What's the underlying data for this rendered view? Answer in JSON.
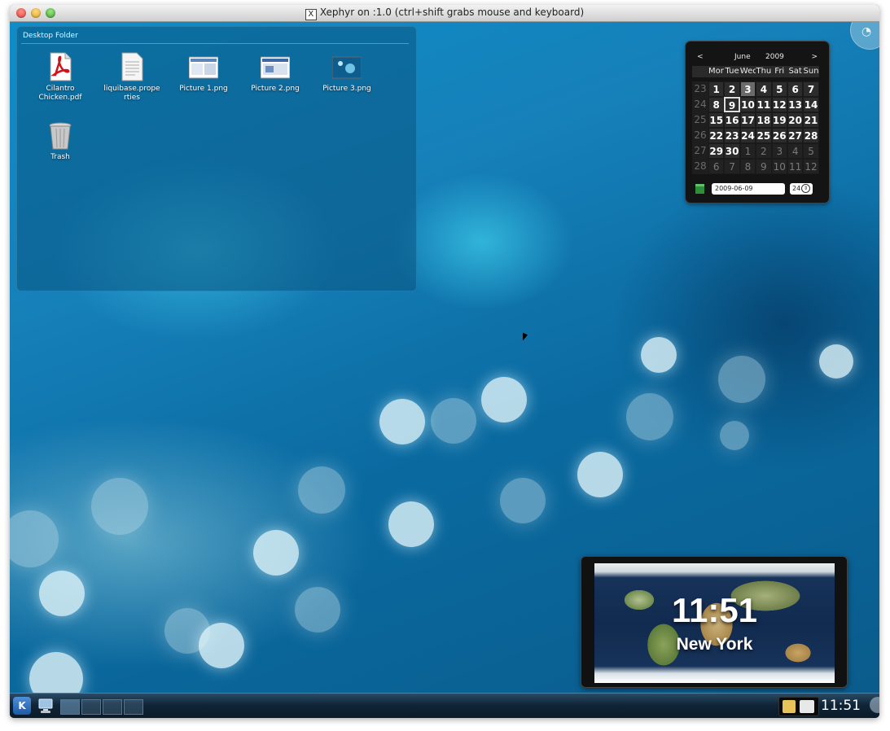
{
  "window": {
    "title": "Xephyr on :1.0 (ctrl+shift grabs mouse and keyboard)",
    "title_icon": "X"
  },
  "folder": {
    "title": "Desktop Folder",
    "items": [
      {
        "label": "Cilantro Chicken.pdf",
        "icon": "pdf-icon"
      },
      {
        "label": "liquibase.properties",
        "icon": "text-file-icon"
      },
      {
        "label": "Picture 1.png",
        "icon": "image-icon"
      },
      {
        "label": "Picture 2.png",
        "icon": "image-icon"
      },
      {
        "label": "Picture 3.png",
        "icon": "image-icon"
      },
      {
        "label": "Trash",
        "icon": "trash-icon"
      }
    ]
  },
  "calendar": {
    "prev": "<",
    "next": ">",
    "month": "June",
    "year": "2009",
    "day_names": [
      "Mon",
      "Tue",
      "Wed",
      "Thu",
      "Fri",
      "Sat",
      "Sun"
    ],
    "weeks": [
      {
        "num": "23",
        "days": [
          "1",
          "2",
          "3",
          "4",
          "5",
          "6",
          "7"
        ]
      },
      {
        "num": "24",
        "days": [
          "8",
          "9",
          "10",
          "11",
          "12",
          "13",
          "14"
        ]
      },
      {
        "num": "25",
        "days": [
          "15",
          "16",
          "17",
          "18",
          "19",
          "20",
          "21"
        ]
      },
      {
        "num": "26",
        "days": [
          "22",
          "23",
          "24",
          "25",
          "26",
          "27",
          "28"
        ]
      },
      {
        "num": "27",
        "days": [
          "29",
          "30",
          "1",
          "2",
          "3",
          "4",
          "5"
        ]
      },
      {
        "num": "28",
        "days": [
          "6",
          "7",
          "8",
          "9",
          "10",
          "11",
          "12"
        ]
      }
    ],
    "today": "3",
    "selected": "9",
    "date_value": "2009-06-09",
    "week_value": "24"
  },
  "world_clock": {
    "time": "11:51",
    "city": "New York"
  },
  "panel": {
    "clock": "11:51",
    "desktops": 4,
    "active_desktop": 1
  },
  "colors": {
    "desktop": "#1680b9",
    "panel": "#0f2537",
    "calendar_bg": "#141414"
  }
}
